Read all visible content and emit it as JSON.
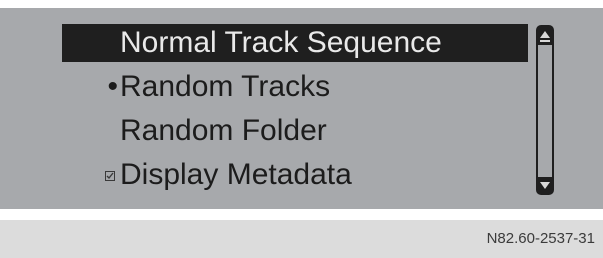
{
  "menu": {
    "items": [
      {
        "label": "Normal Track Sequence",
        "marker": "",
        "selected": true
      },
      {
        "label": "Random Tracks",
        "marker": "•",
        "selected": false
      },
      {
        "label": "Random Folder",
        "marker": "",
        "selected": false
      },
      {
        "label": "Display Metadata",
        "marker": "checkbox-checked",
        "selected": false
      }
    ]
  },
  "scrollbar": {
    "up_icon": "arrow-up-icon",
    "down_icon": "arrow-down-icon"
  },
  "caption": {
    "code": "N82.60-2537-31"
  },
  "colors": {
    "screen_background": "#a7a9ac",
    "selection_background": "#1f1f1f",
    "selection_text": "#e9e9e9",
    "text": "#1c1c1c"
  }
}
